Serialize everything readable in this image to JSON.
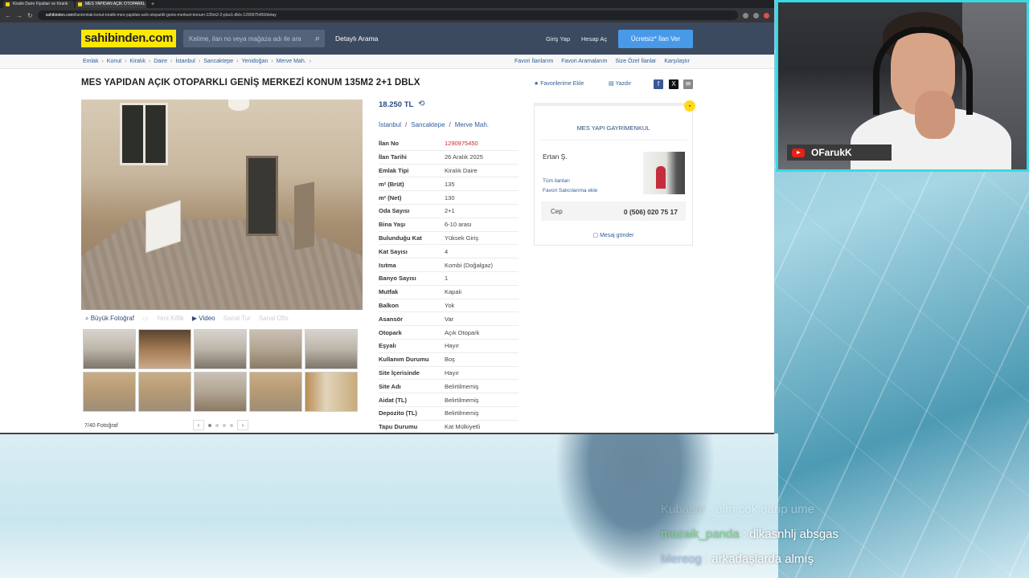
{
  "browser": {
    "tabs": [
      {
        "label": "Kiralık Daire Fiyatları ve Kiralık"
      },
      {
        "label": "MES YAPIDAN AÇIK OTOPARKL"
      }
    ],
    "url_domain": "sahibinden.com",
    "url_path": "/ilan/emlak-konut-kiralik-mes-yapidan-acik-otoparkli-genis-merkezi-konum-135m2-2-plus1-dblx-1290975450/detay"
  },
  "header": {
    "logo": "sahibinden.com",
    "search_placeholder": "Kelime, ilan no veya mağaza adı ile ara",
    "detailed_search": "Detaylı Arama",
    "login": "Giriş Yap",
    "register": "Hesap Aç",
    "post_ad": "Ücretsiz* İlan Ver"
  },
  "breadcrumbs": [
    "Emlak",
    "Konut",
    "Kiralık",
    "Daire",
    "İstanbul",
    "Sancaktepe",
    "Yenidoğan",
    "Merve Mah."
  ],
  "top_links": [
    "Favori İlanlarım",
    "Favori Aramalarım",
    "Size Özel İlanlar",
    "Karşılaştır"
  ],
  "listing": {
    "title": "MES YAPIDAN AÇIK OTOPARKLI GENİŞ MERKEZİ KONUM 135M2 2+1 DBLX",
    "add_favorite": "Favorilerime Ekle",
    "print": "Yazdır",
    "price": "18.250 TL",
    "location": [
      "İstanbul",
      "Sancaktepe",
      "Merve Mah."
    ],
    "photo_tools": [
      "Büyük Fotoğraf",
      "Video"
    ],
    "photo_tools_disabled": [
      "Yeni Kiflik",
      "Sanal Tur",
      "Sanal Ofis"
    ],
    "photo_count": "7/40 Fotoğraf",
    "details": [
      {
        "key": "İlan No",
        "value": "1290975450"
      },
      {
        "key": "İlan Tarihi",
        "value": "26 Aralık 2025"
      },
      {
        "key": "Emlak Tipi",
        "value": "Kiralık Daire"
      },
      {
        "key": "m² (Brüt)",
        "value": "135"
      },
      {
        "key": "m² (Net)",
        "value": "130"
      },
      {
        "key": "Oda Sayısı",
        "value": "2+1"
      },
      {
        "key": "Bina Yaşı",
        "value": "6-10 arası"
      },
      {
        "key": "Bulunduğu Kat",
        "value": "Yüksek Giriş"
      },
      {
        "key": "Kat Sayısı",
        "value": "4"
      },
      {
        "key": "Isıtma",
        "value": "Kombi (Doğalgaz)"
      },
      {
        "key": "Banyo Sayısı",
        "value": "1"
      },
      {
        "key": "Mutfak",
        "value": "Kapalı"
      },
      {
        "key": "Balkon",
        "value": "Yok"
      },
      {
        "key": "Asansör",
        "value": "Var"
      },
      {
        "key": "Otopark",
        "value": "Açık Otopark"
      },
      {
        "key": "Eşyalı",
        "value": "Hayır"
      },
      {
        "key": "Kullanım Durumu",
        "value": "Boş"
      },
      {
        "key": "Site İçerisinde",
        "value": "Hayır"
      },
      {
        "key": "Site Adı",
        "value": "Belirtilmemiş"
      },
      {
        "key": "Aidat (TL)",
        "value": "Belirtilmemiş"
      },
      {
        "key": "Depozito (TL)",
        "value": "Belirtilmemiş"
      },
      {
        "key": "Tapu Durumu",
        "value": "Kat Mülkiyetli"
      }
    ]
  },
  "seller": {
    "agency": "MES YAPI GAYRİMENKUL",
    "name": "Ertan Ş.",
    "all_listings": "Tüm ilanları",
    "add_fav_seller": "Favori Satıcılarıma ekle",
    "phone_label": "Cep",
    "phone": "0 (506) 020 75 17",
    "message": "Mesaj gönder"
  },
  "stream": {
    "streamer": "OFarukK",
    "chat": [
      {
        "user": "Kubasar",
        "text": "olm cok garip ume"
      },
      {
        "user": "mozaik_panda",
        "text": "dlkasnhlj absgas"
      },
      {
        "user": "Mereog",
        "text": "arkadaşlarda almış"
      }
    ]
  },
  "colors": {
    "brand_yellow": "#ffe800",
    "header_bg": "#3c4a5f",
    "accent_blue": "#489ae9",
    "link": "#2f5d9c",
    "id_red": "#d0262b",
    "webcam_border": "#38d9e4"
  }
}
